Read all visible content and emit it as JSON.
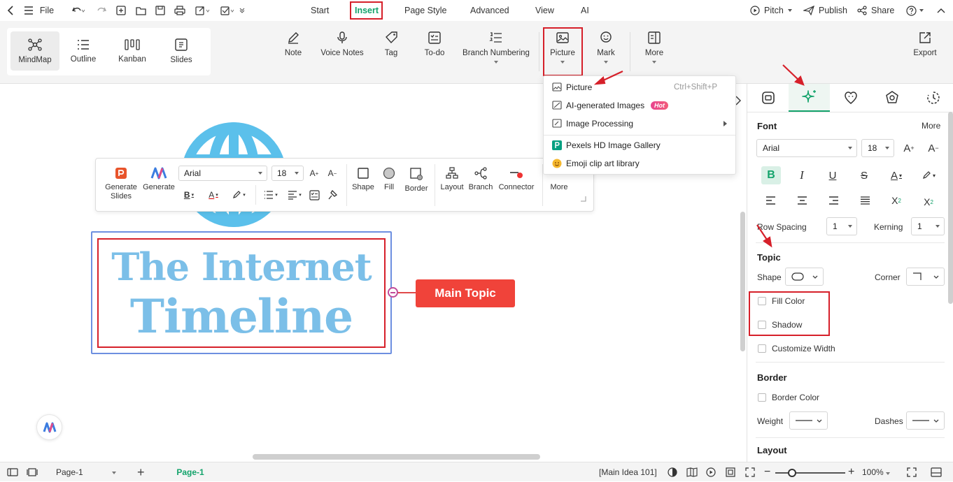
{
  "topbar": {
    "file": "File",
    "tabs": [
      "Start",
      "Insert",
      "Page Style",
      "Advanced",
      "View",
      "AI"
    ],
    "pitch": "Pitch",
    "publish": "Publish",
    "share": "Share"
  },
  "ribbon": {
    "views": [
      "MindMap",
      "Outline",
      "Kanban",
      "Slides"
    ],
    "buttons": {
      "note": "Note",
      "voice_notes": "Voice Notes",
      "tag": "Tag",
      "todo": "To-do",
      "branch_numbering": "Branch Numbering",
      "picture": "Picture",
      "mark": "Mark",
      "more": "More",
      "export": "Export"
    }
  },
  "picture_menu": {
    "items": [
      {
        "label": "Picture",
        "shortcut": "Ctrl+Shift+P"
      },
      {
        "label": "AI-generated Images",
        "badge": "Hot"
      },
      {
        "label": "Image Processing"
      },
      {
        "label": "Pexels HD Image Gallery"
      },
      {
        "label": "Emoji clip art library"
      }
    ]
  },
  "floatbar": {
    "generate_slides_1": "Generate",
    "generate_slides_2": "Slides",
    "generate": "Generate",
    "font": "Arial",
    "size": "18",
    "shape": "Shape",
    "fill": "Fill",
    "border": "Border",
    "layout": "Layout",
    "branch": "Branch",
    "connector": "Connector",
    "more": "More"
  },
  "canvas": {
    "title_line1": "The Internet",
    "title_line2": "Timeline",
    "main_topic": "Main Topic"
  },
  "rpanel": {
    "font_heading": "Font",
    "more": "More",
    "font": "Arial",
    "size": "18",
    "row_spacing_label": "Row Spacing",
    "row_spacing": "1",
    "kerning_label": "Kerning",
    "kerning": "1",
    "topic_heading": "Topic",
    "shape_label": "Shape",
    "corner_label": "Corner",
    "fill_color": "Fill Color",
    "shadow": "Shadow",
    "customize_width": "Customize Width",
    "border_heading": "Border",
    "border_color": "Border Color",
    "weight_label": "Weight",
    "dashes_label": "Dashes",
    "layout_heading": "Layout"
  },
  "statusbar": {
    "page_select": "Page-1",
    "page_tab": "Page-1",
    "main_idea": "[Main Idea 101]",
    "zoom": "100%"
  },
  "colors": {
    "accent": "#13a36b",
    "annotation_red": "#d6202a",
    "main_topic_bg": "#f0433a",
    "title_blue": "#7bbfe8",
    "globe_blue": "#5bc0eb"
  }
}
